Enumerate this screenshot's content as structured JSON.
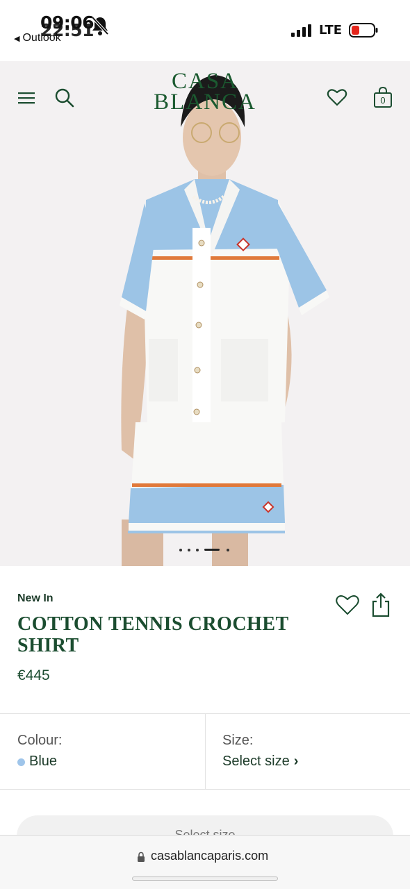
{
  "status_bar": {
    "time_primary": "09:06",
    "time_secondary": "22:51",
    "back_app": "Outlook",
    "network": "LTE",
    "icons": [
      "bell-slash-icon",
      "signal-icon",
      "battery-icon"
    ]
  },
  "header": {
    "logo_line1": "CASA",
    "logo_line2": "BLANCA",
    "bag_count": "0",
    "icons": [
      "menu-icon",
      "search-icon",
      "heart-icon",
      "bag-icon"
    ],
    "brand_color": "#1b5a30"
  },
  "carousel": {
    "slide_count": 5,
    "active_index": 3
  },
  "product": {
    "tag": "New In",
    "title": "COTTON TENNIS CROCHET SHIRT",
    "price": "€445",
    "icons": [
      "heart-icon",
      "share-icon"
    ]
  },
  "options": {
    "colour_label": "Colour:",
    "colour_value": "Blue",
    "colour_swatch": "#9fc5ea",
    "size_label": "Size:",
    "size_value": "Select size",
    "size_chevron": "›"
  },
  "add_button": {
    "label": "Select size"
  },
  "browser": {
    "url": "casablancaparis.com",
    "icons": [
      "lock-icon"
    ]
  }
}
